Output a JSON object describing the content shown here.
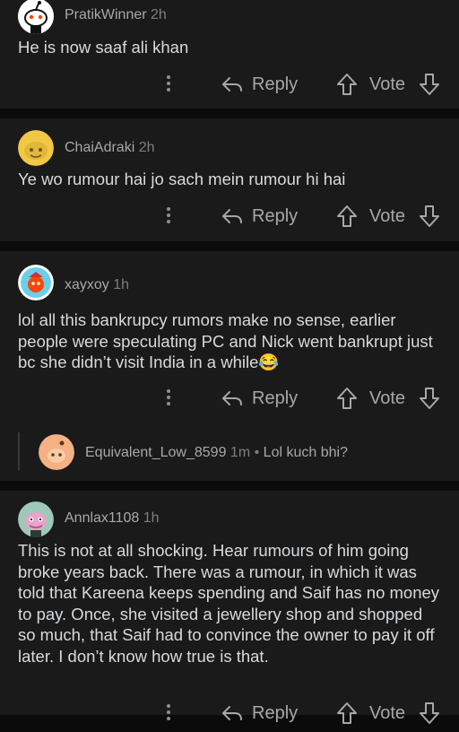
{
  "comments": [
    {
      "username": "PratikWinner",
      "time": "2h",
      "text": "He is now saaf ali khan",
      "reply_label": "Reply",
      "vote_label": "Vote"
    },
    {
      "username": "ChaiAdraki",
      "time": "2h",
      "text": "Ye wo rumour hai jo sach mein rumour hi hai",
      "reply_label": "Reply",
      "vote_label": "Vote"
    },
    {
      "username": "xayxoy",
      "time": "1h",
      "text": "lol all this bankrupcy rumors make no sense, earlier people were speculating PC and Nick went bankrupt just bc she didn’t visit India in a while😂",
      "reply_label": "Reply",
      "vote_label": "Vote"
    },
    {
      "username": "Annlax1108",
      "time": "1h",
      "text": "This is not at all shocking. Hear rumours of him going broke years back. There was a rumour, in which it was told that Kareena keeps spending and Saif has no money to pay. Once, she visited a jewellery shop and shopped so much, that Saif had to convince the owner to pay it off later. I don’t know how true is that.",
      "reply_label": "Reply",
      "vote_label": "Vote"
    }
  ],
  "collapsed_reply": {
    "username": "Equivalent_Low_8599",
    "time": "1m",
    "separator": "•",
    "text": "Lol kuch bhi?"
  },
  "icons": {
    "avatar": "avatar-icon",
    "kebab": "more-options-icon",
    "reply": "reply-arrow-icon",
    "upvote": "upvote-arrow-icon",
    "downvote": "downvote-arrow-icon"
  },
  "colors": {
    "background": "#0b0b0b",
    "card": "#1a1a1b",
    "text": "#d7dadc",
    "muted": "#a6a8a9"
  }
}
